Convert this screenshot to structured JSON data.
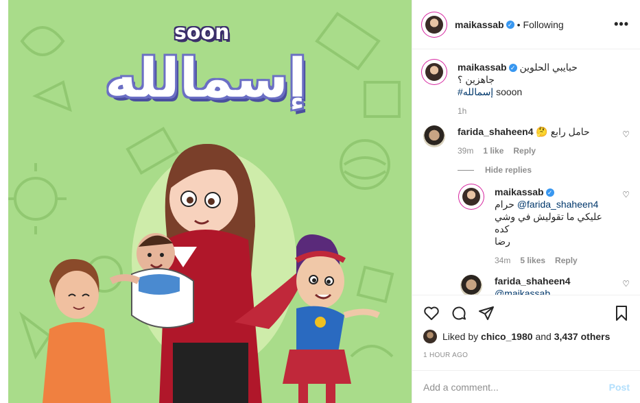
{
  "media": {
    "soon_text": "soon",
    "title_text": "إسمالله"
  },
  "header": {
    "username": "maikassab",
    "separator": "•",
    "follow_status": "Following",
    "more_label": "•••"
  },
  "caption": {
    "username": "maikassab",
    "line1": "حبايبي الحلوين جاهزين ؟",
    "hashtag": "#إسمالله",
    "line2_suffix": "sooon",
    "time": "1h"
  },
  "comments": [
    {
      "username": "farida_shaheen4",
      "text": "حامل رابع 🤔",
      "time": "39m",
      "likes": "1 like",
      "reply_label": "Reply"
    }
  ],
  "hide_replies_label": "Hide replies",
  "replies": [
    {
      "username": "maikassab",
      "text_prefix": "حرام",
      "mention": "@farida_shaheen4",
      "text_line2": "عليكي ما تقوليش في وشي كده",
      "text_line3": "رضا",
      "time": "34m",
      "likes": "5 likes",
      "reply_label": "Reply"
    },
    {
      "username": "farida_shaheen4",
      "text": "@maikassab ..."
    }
  ],
  "likes": {
    "prefix": "Liked by",
    "user": "chico_1980",
    "middle": "and",
    "others": "3,437 others"
  },
  "post_time": "1 HOUR AGO",
  "add_comment": {
    "placeholder": "Add a comment...",
    "post_label": "Post"
  },
  "colors": {
    "media_bg": "#a9dc8a",
    "verified": "#3897f0",
    "post_disabled": "#b2dffc"
  }
}
